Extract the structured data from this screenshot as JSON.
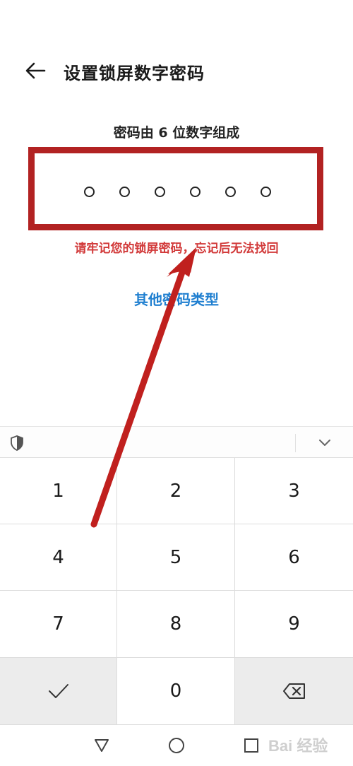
{
  "header": {
    "title": "设置锁屏数字密码",
    "back_icon": "arrow-left-icon"
  },
  "pin": {
    "hint": "密码由 6 位数字组成",
    "length": 6,
    "entered": 0,
    "highlight_color": "#b22222"
  },
  "warning": {
    "text": "请牢记您的锁屏密码，忘记后无法找回",
    "color": "#d23a3a"
  },
  "other_type": {
    "label": "其他密码类型",
    "color": "#1f7fd0"
  },
  "keyboard_toolbar": {
    "security_icon": "shield-icon",
    "collapse_icon": "chevron-down-icon"
  },
  "keypad": {
    "keys": [
      "1",
      "2",
      "3",
      "4",
      "5",
      "6",
      "7",
      "8",
      "9"
    ],
    "confirm_icon": "checkmark-icon",
    "zero": "0",
    "delete_icon": "backspace-icon"
  },
  "nav": {
    "back_icon": "triangle-back-icon",
    "home_icon": "circle-home-icon",
    "recent_icon": "square-recent-icon"
  },
  "watermark": {
    "text": "Bai 经验"
  },
  "annotation": {
    "arrow_color": "#c0201e"
  }
}
